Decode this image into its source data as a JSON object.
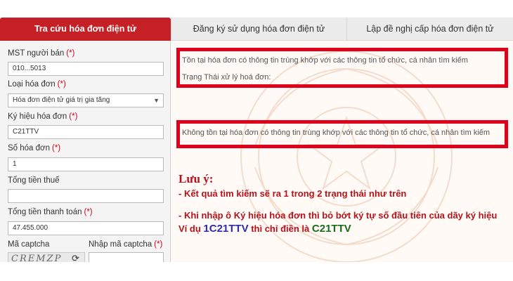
{
  "tabs": [
    {
      "label": "Tra cứu hóa đơn điện tử",
      "active": true
    },
    {
      "label": "Đăng ký sử dụng hóa đơn điện tử",
      "active": false
    },
    {
      "label": "Lập đề nghị cấp hóa đơn điện tử",
      "active": false
    }
  ],
  "form": {
    "mst_label": "MST người bán",
    "mst_value": "010...5013",
    "loai_label": "Loại hóa đơn",
    "loai_value": "Hóa đơn điện tử giá trị gia tăng",
    "kyhieu_label": "Ký hiệu hóa đơn",
    "kyhieu_value": "C21TTV",
    "so_label": "Số hóa đơn",
    "so_value": "1",
    "tienthue_label": "Tổng tiền thuế",
    "tienthue_value": "",
    "thanhtoan_label": "Tổng tiền thanh toán",
    "thanhtoan_value": "47.455.000",
    "captcha_label": "Mã captcha",
    "captcha_input_label": "Nhập mã captcha",
    "captcha_text": "CREMZP",
    "required_mark": "(*)"
  },
  "results": {
    "found_text": "Tồn tại hóa đơn có thông tin trùng khớp với các thông tin tổ chức, cá nhân tìm kiếm",
    "status_text": "Trạng Thái xử lý hoá đơn:",
    "not_found_text": "Không tồn tại hóa đơn có thông tin trùng khớp với các thông tin tổ chức, cá nhân tìm kiếm"
  },
  "note": {
    "title": "Lưu ý:",
    "line1": "- Kết quả tìm kiếm sẽ ra 1 trong 2 trạng thái như trên",
    "line2": "- Khi nhập ô Ký hiệu hóa đơn thì bỏ bớt ký tự số đầu tiên của dãy ký hiệu",
    "line3_prefix": "Ví dụ ",
    "line3_code_full": "1C21TTV",
    "line3_mid": " thì chỉ điền là ",
    "line3_code_short": "C21TTV"
  },
  "colors": {
    "accent": "#c52026",
    "highlight": "#e1001a",
    "note_red": "#b5121b",
    "code_blue": "#2b2dab",
    "code_green": "#1a6b1a"
  }
}
